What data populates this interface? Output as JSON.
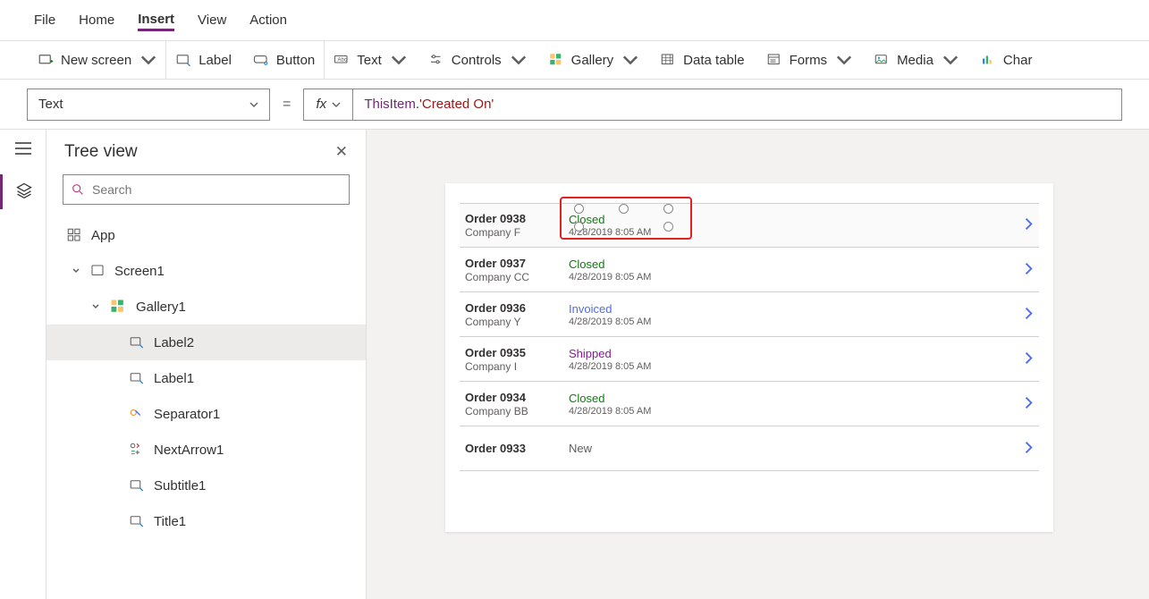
{
  "menu": {
    "file": "File",
    "home": "Home",
    "insert": "Insert",
    "view": "View",
    "action": "Action"
  },
  "ribbon": {
    "new_screen": "New screen",
    "label": "Label",
    "button": "Button",
    "text": "Text",
    "controls": "Controls",
    "gallery": "Gallery",
    "data_table": "Data table",
    "forms": "Forms",
    "media": "Media",
    "chart": "Char"
  },
  "formula": {
    "property": "Text",
    "equals": "=",
    "fx": "fx",
    "tok1": "ThisItem",
    "dot": ".",
    "tok2": "'Created On'"
  },
  "tree": {
    "title": "Tree view",
    "search_placeholder": "Search",
    "app": "App",
    "screen": "Screen1",
    "gallery": "Gallery1",
    "items": [
      "Label2",
      "Label1",
      "Separator1",
      "NextArrow1",
      "Subtitle1",
      "Title1"
    ]
  },
  "canvas": {
    "rows": [
      {
        "order": "Order 0938",
        "company": "Company F",
        "status": "Closed",
        "status_class": "closed",
        "date": "4/28/2019 8:05 AM"
      },
      {
        "order": "Order 0937",
        "company": "Company CC",
        "status": "Closed",
        "status_class": "closed",
        "date": "4/28/2019 8:05 AM"
      },
      {
        "order": "Order 0936",
        "company": "Company Y",
        "status": "Invoiced",
        "status_class": "invoiced",
        "date": "4/28/2019 8:05 AM"
      },
      {
        "order": "Order 0935",
        "company": "Company I",
        "status": "Shipped",
        "status_class": "shipped",
        "date": "4/28/2019 8:05 AM"
      },
      {
        "order": "Order 0934",
        "company": "Company BB",
        "status": "Closed",
        "status_class": "closed",
        "date": "4/28/2019 8:05 AM"
      },
      {
        "order": "Order 0933",
        "company": "",
        "status": "New",
        "status_class": "new",
        "date": ""
      }
    ]
  }
}
